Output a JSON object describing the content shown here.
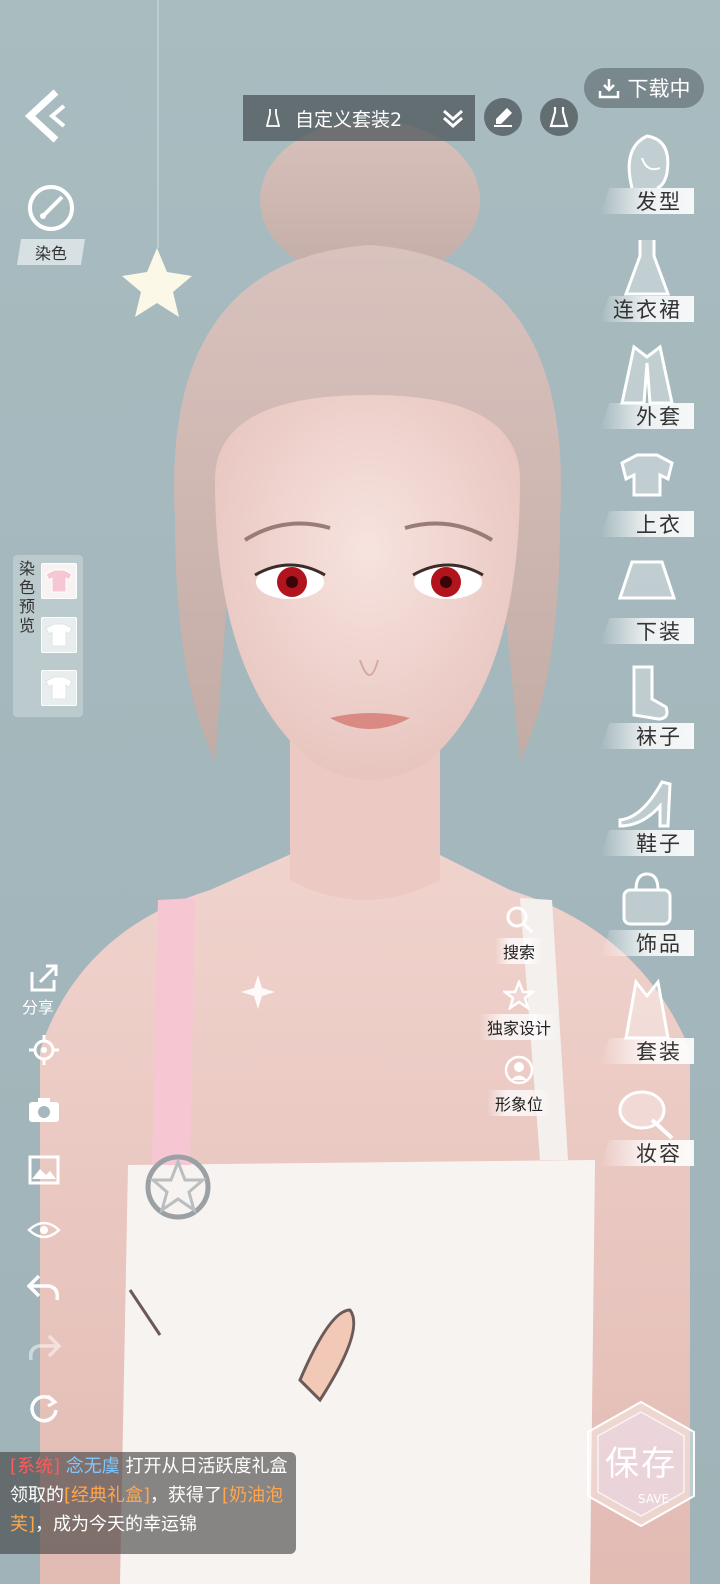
{
  "outfit_selector": {
    "name": "自定义套装2"
  },
  "download": {
    "label": "下载中"
  },
  "dye": {
    "label": "染色"
  },
  "dye_preview": {
    "label": "染色预览",
    "chars": [
      "染",
      "色",
      "预",
      "览"
    ]
  },
  "categories": [
    {
      "label": "发型",
      "icon": "hair-icon"
    },
    {
      "label": "连衣裙",
      "icon": "dress-icon"
    },
    {
      "label": "外套",
      "icon": "coat-icon"
    },
    {
      "label": "上衣",
      "icon": "top-icon"
    },
    {
      "label": "下装",
      "icon": "skirt-icon"
    },
    {
      "label": "袜子",
      "icon": "socks-icon"
    },
    {
      "label": "鞋子",
      "icon": "shoes-icon"
    },
    {
      "label": "饰品",
      "icon": "bag-icon"
    },
    {
      "label": "套装",
      "icon": "suit-icon"
    },
    {
      "label": "妆容",
      "icon": "makeup-icon"
    }
  ],
  "mid_actions": {
    "search": "搜索",
    "exclusive": "独家设计",
    "image": "形象位"
  },
  "tools": {
    "share": "分享"
  },
  "chat": {
    "tag": "[系统]",
    "user": "念无虞",
    "text1": "打开从日活跃度礼盒领取的",
    "item1": "[经典礼盒]",
    "text2": "，获得了",
    "item2": "[奶油泡芙]",
    "text3": "，成为今天的幸运锦"
  },
  "save": {
    "label": "保存",
    "sub": "SAVE"
  },
  "colors": {
    "accent_pink": "#f7c6d3",
    "panel_dark": "#465054"
  }
}
